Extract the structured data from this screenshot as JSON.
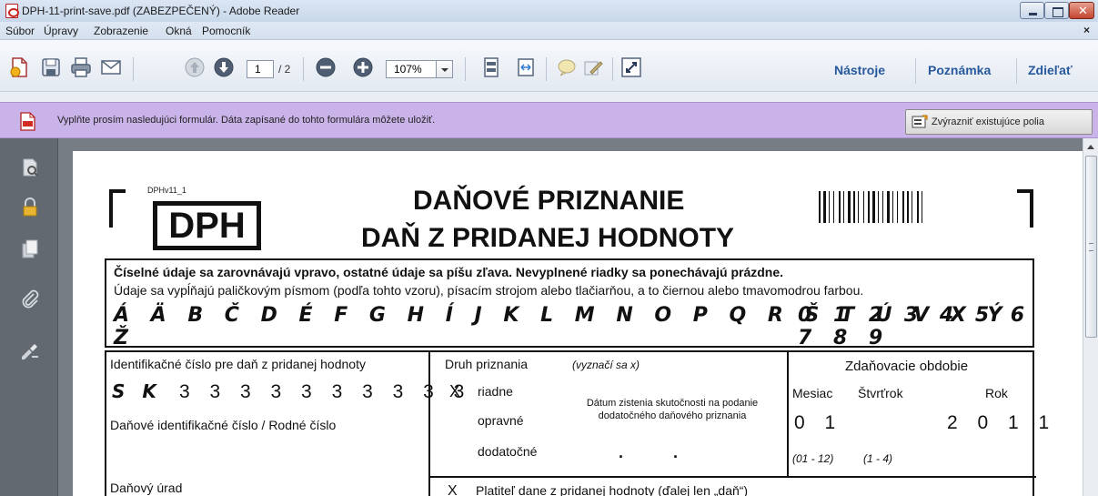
{
  "window": {
    "title": "DPH-11-print-save.pdf (ZABEZPEČENÝ) - Adobe Reader"
  },
  "menu": {
    "items": [
      "Súbor",
      "Úpravy",
      "Zobrazenie",
      "Okná",
      "Pomocník"
    ],
    "close": "×"
  },
  "toolbar": {
    "page_current": "1",
    "page_total": "/ 2",
    "zoom": "107%",
    "links": [
      "Nástroje",
      "Poznámka",
      "Zdieľať"
    ]
  },
  "formbar": {
    "message": "Vyplňte prosím nasledujúci formulár. Dáta zapísané do tohto formulára môžete uložiť.",
    "highlight_button": "Zvýrazniť existujúce polia"
  },
  "document": {
    "form_code": "DPHv11_1",
    "logo": "DPH",
    "title_line1": "DAŇOVÉ PRIZNANIE",
    "title_line2": "DAŇ Z PRIDANEJ HODNOTY",
    "instructions_bold": "Číselné údaje sa zarovnávajú vpravo, ostatné údaje sa píšu zľava. Nevyplnené riadky sa ponechávajú prázdne.",
    "instructions": "Údaje sa vypĺňajú paličkovým písmom (podľa tohto vzoru), písacím strojom alebo tlačiarňou, a to čiernou alebo tmavomodrou farbou.",
    "sample_letters": "Á Ä B Č D É F G H Í J K L M N O P Q R Š T Ú V X Ý Ž",
    "sample_digits": "0 1 2 3 4 5 6 7 8 9",
    "id_label": "Identifikačné číslo pre daň z pridanej hodnoty",
    "id_prefix": "S K",
    "id_value": "3 3 3 3 3 3 3 3 3 3",
    "dic_label": "Daňové identifikačné číslo / Rodné číslo",
    "tax_office_label": "Daňový úrad",
    "type_label": "Druh priznania",
    "type_hint": "(vyznačí sa x)",
    "type_riadne": "riadne",
    "type_opravne": "opravné",
    "type_dodatocne": "dodatočné",
    "mark_x": "X",
    "date_label": "Dátum zistenia skutočnosti na podanie dodatočného daňového priznania",
    "date_dots": ".           .",
    "period_label": "Zdaňovacie obdobie",
    "month_label": "Mesiac",
    "quarter_label": "Štvrťrok",
    "year_label": "Rok",
    "month_value": "0 1",
    "year_value": "2 0 1 1",
    "month_range": "(01 - 12)",
    "quarter_range": "(1 - 4)",
    "payer_label": "Platiteľ dane z pridanej hodnoty (ďalej len „daň“)"
  },
  "colors": {
    "formbar_bg": "#c9b3e8",
    "link_blue": "#27599c",
    "left_panel": "#626971",
    "doc_bg": "#767d85"
  }
}
